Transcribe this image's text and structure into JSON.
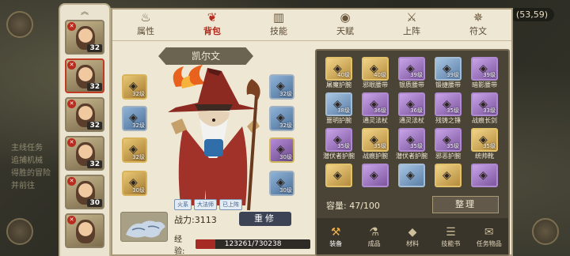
{
  "coords": "(53,59)",
  "world_text": [
    "主线任务",
    "追捕机械",
    "得胜的冒险",
    "并前往"
  ],
  "heroes": [
    {
      "level": "32",
      "selected": false
    },
    {
      "level": "32",
      "selected": true
    },
    {
      "level": "32",
      "selected": false
    },
    {
      "level": "32",
      "selected": false
    },
    {
      "level": "30",
      "selected": false
    },
    {
      "level": "",
      "selected": false
    }
  ],
  "tabs": [
    {
      "label": "属性",
      "icon": "flame-icon"
    },
    {
      "label": "背包",
      "icon": "bag-icon",
      "active": true
    },
    {
      "label": "技能",
      "icon": "book-icon"
    },
    {
      "label": "天赋",
      "icon": "eye-icon"
    },
    {
      "label": "上阵",
      "icon": "swords-icon"
    },
    {
      "label": "符文",
      "icon": "rune-icon"
    }
  ],
  "character": {
    "name": "凯尔文",
    "tags": [
      "火系",
      "大法师",
      "已上阵"
    ],
    "power_label": "战力:3113",
    "rebuild_label": "重修",
    "exp_label": "经验:",
    "exp_text": "123261/730238",
    "exp_fraction": 0.169,
    "left_slots": [
      {
        "level": "32级",
        "rarity": "gold"
      },
      {
        "level": "32级",
        "rarity": "blue"
      },
      {
        "level": "32级",
        "rarity": "gold"
      },
      {
        "level": "30级",
        "rarity": "gold"
      }
    ],
    "right_slots": [
      {
        "level": "32级",
        "rarity": "blue"
      },
      {
        "level": "32级",
        "rarity": "blue"
      },
      {
        "level": "30级",
        "rarity": "purple"
      },
      {
        "level": "30级",
        "rarity": "blue"
      }
    ]
  },
  "bag": {
    "items": [
      {
        "name": "屠魔护腕",
        "level": "40级",
        "rarity": "gold"
      },
      {
        "name": "邪眼腰带",
        "level": "40级",
        "rarity": "gold"
      },
      {
        "name": "银质腰带",
        "level": "39级",
        "rarity": "purple"
      },
      {
        "name": "锻捷腰带",
        "level": "39级",
        "rarity": "blue"
      },
      {
        "name": "暗影腰带",
        "level": "39级",
        "rarity": "purple"
      },
      {
        "name": "噩明护腕",
        "level": "38级",
        "rarity": "blue"
      },
      {
        "name": "通灵法杖",
        "level": "36级",
        "rarity": "purple"
      },
      {
        "name": "通灵法杖",
        "level": "36级",
        "rarity": "purple"
      },
      {
        "name": "残铸之锤",
        "level": "35级",
        "rarity": "purple"
      },
      {
        "name": "战痕长剑",
        "level": "33级",
        "rarity": "purple"
      },
      {
        "name": "潜伏者护腕",
        "level": "35级",
        "rarity": "purple"
      },
      {
        "name": "战痕护腕",
        "level": "35级",
        "rarity": "gold"
      },
      {
        "name": "潜伏者护腕",
        "level": "35级",
        "rarity": "purple"
      },
      {
        "name": "邪恶护腕",
        "level": "35级",
        "rarity": "purple"
      },
      {
        "name": "统帅靴",
        "level": "35级",
        "rarity": "gold"
      },
      {
        "name": "",
        "level": "",
        "rarity": "gold"
      },
      {
        "name": "",
        "level": "",
        "rarity": "purple"
      },
      {
        "name": "",
        "level": "",
        "rarity": "blue"
      },
      {
        "name": "",
        "level": "",
        "rarity": "gold"
      },
      {
        "name": "",
        "level": "",
        "rarity": "purple"
      }
    ],
    "capacity_label": "容量:",
    "capacity_value": "47/100",
    "sort_label": "整理"
  },
  "bottom_tabs": [
    {
      "label": "装备",
      "icon": "hammer-icon",
      "active": true
    },
    {
      "label": "成品",
      "icon": "potion-icon"
    },
    {
      "label": "材料",
      "icon": "ore-icon"
    },
    {
      "label": "技能书",
      "icon": "scroll-icon"
    },
    {
      "label": "任务物品",
      "icon": "quest-icon"
    }
  ]
}
